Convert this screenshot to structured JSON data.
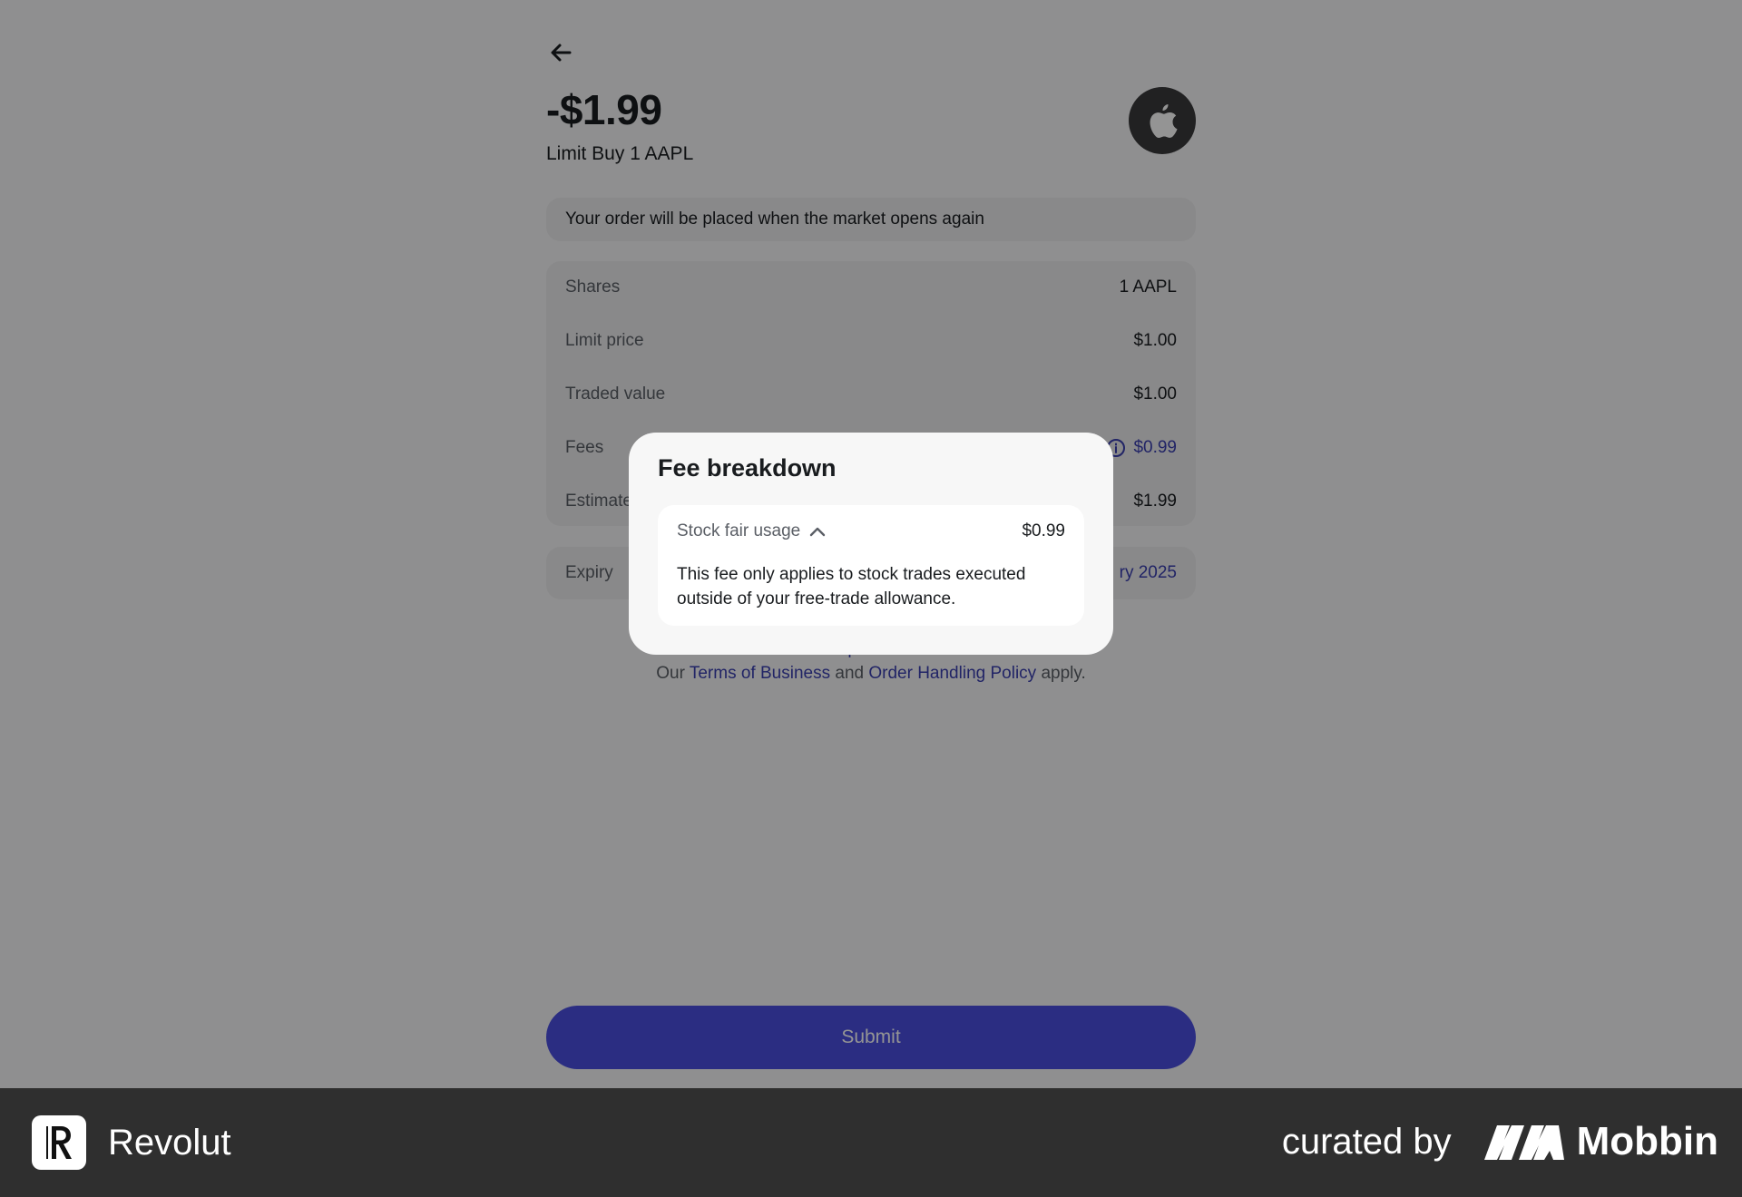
{
  "order": {
    "amount": "-$1.99",
    "subtitle": "Limit Buy 1 AAPL",
    "logo": "apple-icon",
    "notice": "Your order will be placed when the market opens again"
  },
  "details": [
    {
      "label": "Shares",
      "value": "1 AAPL"
    },
    {
      "label": "Limit price",
      "value": "$1.00"
    },
    {
      "label": "Traded value",
      "value": "$1.00"
    },
    {
      "label": "Fees",
      "value": "$0.99"
    },
    {
      "label": "Estimated total",
      "value": "$1.99"
    }
  ],
  "expiry": {
    "label": "Expiry",
    "value": "ry 2025"
  },
  "legal": {
    "risk": "Your capital is at risk.",
    "prefix": "Our",
    "terms": "Terms of Business",
    "and": "and",
    "policy": "Order Handling Policy",
    "suffix": "apply."
  },
  "submit_label": "Submit",
  "modal": {
    "title": "Fee breakdown",
    "item_name": "Stock fair usage",
    "item_value": "$0.99",
    "description": "This fee only applies to stock trades executed outside of your free-trade allowance."
  },
  "footer": {
    "brand": "Revolut",
    "curated_by": "curated by",
    "curator": "Mobbin"
  },
  "colors": {
    "accent": "#4a4fe0",
    "link": "#3a3fb0",
    "footer_bg": "#2f2f2f"
  }
}
